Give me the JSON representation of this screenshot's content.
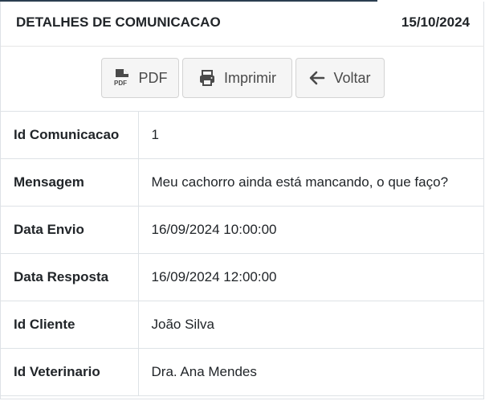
{
  "header": {
    "title": "DETALHES DE COMUNICACAO",
    "date": "15/10/2024"
  },
  "toolbar": {
    "pdf": {
      "label": "PDF",
      "icon": "pdf-file-icon"
    },
    "print": {
      "label": "Imprimir",
      "icon": "printer-icon"
    },
    "back": {
      "label": "Voltar",
      "icon": "arrow-left-icon"
    }
  },
  "details": [
    {
      "label": "Id Comunicacao",
      "value": "1"
    },
    {
      "label": "Mensagem",
      "value": "Meu cachorro ainda está mancando, o que faço?"
    },
    {
      "label": "Data Envio",
      "value": "16/09/2024 10:00:00"
    },
    {
      "label": "Data Resposta",
      "value": "16/09/2024 12:00:00"
    },
    {
      "label": "Id Cliente",
      "value": "João Silva"
    },
    {
      "label": "Id Veterinario",
      "value": "Dra. Ana Mendes"
    }
  ],
  "colors": {
    "accent_line": "#2b3e50",
    "button_bg": "#f5f5f5",
    "border": "#dee2e6"
  }
}
